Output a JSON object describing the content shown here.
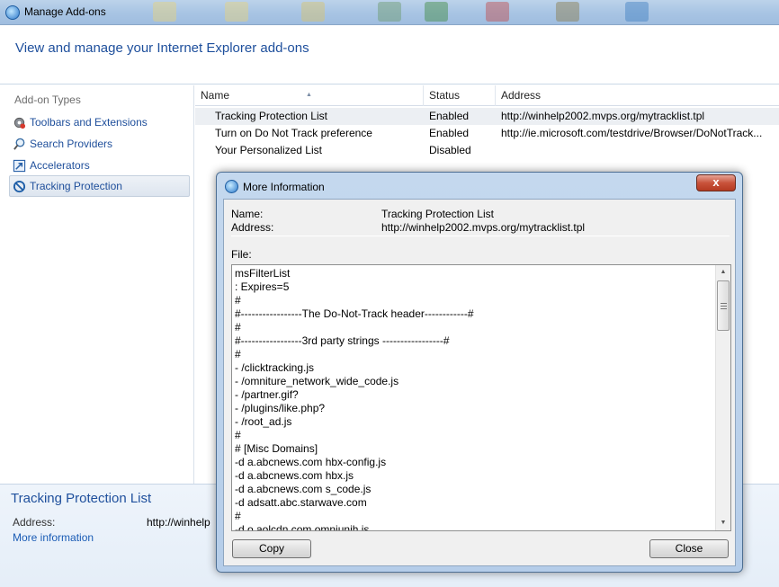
{
  "window": {
    "title": "Manage Add-ons"
  },
  "header": {
    "title": "View and manage your Internet Explorer add-ons"
  },
  "sidebar": {
    "heading": "Add-on Types",
    "items": [
      {
        "label": "Toolbars and Extensions",
        "icon": "gear-icon"
      },
      {
        "label": "Search Providers",
        "icon": "magnifier-icon"
      },
      {
        "label": "Accelerators",
        "icon": "accelerator-icon"
      },
      {
        "label": "Tracking Protection",
        "icon": "no-sign-icon",
        "selected": true
      }
    ]
  },
  "list": {
    "columns": [
      "Name",
      "Status",
      "Address"
    ],
    "rows": [
      {
        "name": "Tracking Protection List",
        "status": "Enabled",
        "address": "http://winhelp2002.mvps.org/mytracklist.tpl"
      },
      {
        "name": "Turn on Do Not Track preference",
        "status": "Enabled",
        "address": "http://ie.microsoft.com/testdrive/Browser/DoNotTrack..."
      },
      {
        "name": "Your Personalized List",
        "status": "Disabled",
        "address": ""
      }
    ]
  },
  "details": {
    "title": "Tracking Protection List",
    "address_label": "Address:",
    "address_value": "http://winhelp",
    "more_info_link": "More information"
  },
  "dialog": {
    "title": "More Information",
    "close_glyph": "x",
    "name_label": "Name:",
    "name_value": "Tracking Protection List",
    "address_label": "Address:",
    "address_value": "http://winhelp2002.mvps.org/mytracklist.tpl",
    "file_label": "File:",
    "file_lines": [
      "msFilterList",
      ": Expires=5",
      "#",
      "#-----------------The Do-Not-Track header------------#",
      "#",
      "#-----------------3rd party strings -----------------#",
      "#",
      "- /clicktracking.js",
      "- /omniture_network_wide_code.js",
      "- /partner.gif?",
      "- /plugins/like.php?",
      "- /root_ad.js",
      "#",
      "# [Misc Domains]",
      "-d a.abcnews.com hbx-config.js",
      "-d a.abcnews.com hbx.js",
      "-d a.abcnews.com s_code.js",
      "-d adsatt.abc.starwave.com",
      "#",
      "-d o.aolcdn.com omniunih.js"
    ],
    "copy_button": "Copy",
    "close_button": "Close"
  },
  "colors": {
    "accent_text": "#1e4f9c",
    "link": "#1a5bb5",
    "close_button_red": "#c9533b"
  }
}
